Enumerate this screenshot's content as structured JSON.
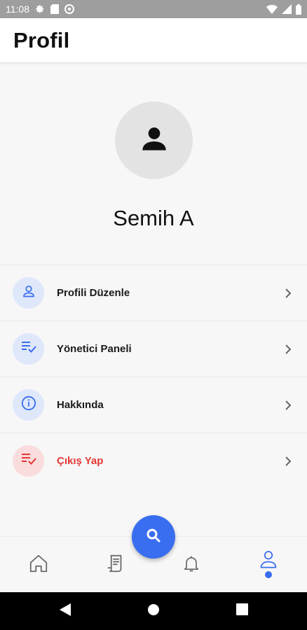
{
  "status_bar": {
    "time": "11:08",
    "left_icons": [
      "gear-icon",
      "sd-card-icon",
      "at-sign-icon"
    ],
    "right_icons": [
      "wifi-icon",
      "signal-icon",
      "battery-icon"
    ]
  },
  "header": {
    "title": "Profil"
  },
  "profile": {
    "avatar_icon": "person-icon",
    "name": "Semih A"
  },
  "menu": {
    "items": [
      {
        "label": "Profili Düzenle",
        "icon": "user-outline-icon",
        "tone": "blue"
      },
      {
        "label": "Yönetici Paneli",
        "icon": "list-check-icon",
        "tone": "blue"
      },
      {
        "label": "Hakkında",
        "icon": "info-icon",
        "tone": "blue"
      },
      {
        "label": "Çıkış Yap",
        "icon": "list-check-icon",
        "tone": "red"
      }
    ]
  },
  "bottom_nav": {
    "items": [
      "home-icon",
      "receipt-icon",
      "bell-icon",
      "profile-icon"
    ],
    "active": "profile-icon",
    "fab_icon": "search-icon"
  },
  "system_nav": {
    "items": [
      "back-icon",
      "home-circle-icon",
      "recents-icon"
    ]
  },
  "colors": {
    "accent": "#3a6ef0",
    "danger": "#e53935",
    "accent_light": "#dfe7fb",
    "danger_light": "#fbdcdc"
  }
}
